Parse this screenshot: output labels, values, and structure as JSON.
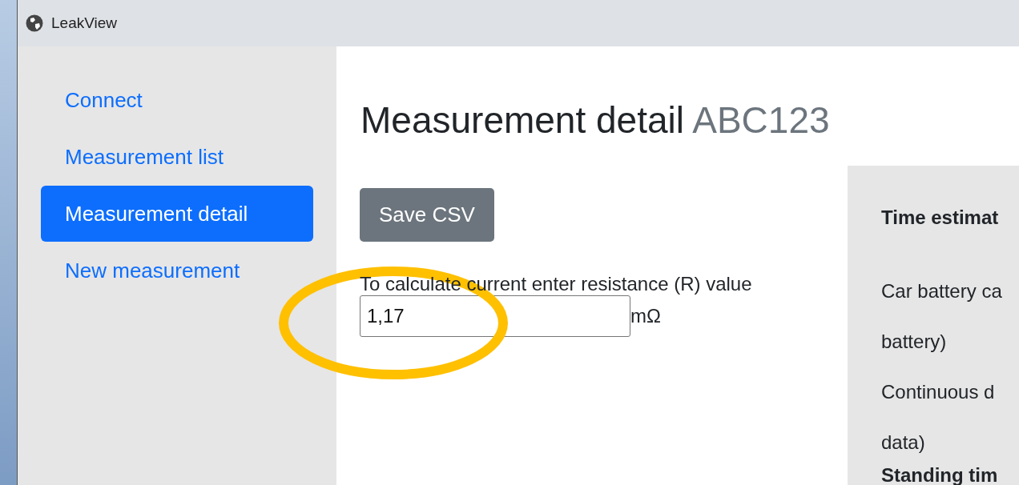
{
  "window": {
    "title": "LeakView"
  },
  "sidebar": {
    "items": [
      {
        "label": "Connect",
        "selected": false
      },
      {
        "label": "Measurement list",
        "selected": false
      },
      {
        "label": "Measurement detail",
        "selected": true
      },
      {
        "label": "New measurement",
        "selected": false
      }
    ]
  },
  "page": {
    "title": "Measurement detail",
    "subtitle": "ABC123"
  },
  "save_button": "Save CSV",
  "resistance": {
    "label": "To calculate current enter resistance (R) value",
    "value": "1,17",
    "unit": "mΩ"
  },
  "time_panel": {
    "items": [
      {
        "kind": "heading",
        "text": "Time estimat"
      },
      {
        "kind": "text",
        "text": "Car battery ca"
      },
      {
        "kind": "text",
        "text": "battery)"
      },
      {
        "kind": "text",
        "text": "Continuous d"
      },
      {
        "kind": "text",
        "text": "data)"
      },
      {
        "kind": "subheading",
        "text": "Standing tim"
      }
    ]
  }
}
